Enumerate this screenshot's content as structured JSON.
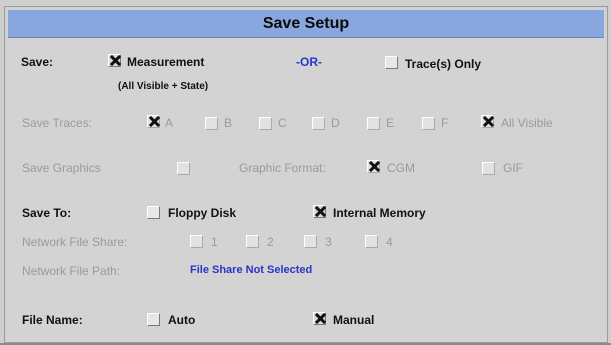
{
  "title": "Save Setup",
  "save": {
    "label": "Save:",
    "measurement": {
      "label": "Measurement",
      "checked": true
    },
    "measurement_note": "(All Visible + State)",
    "or": "-OR-",
    "traces_only": {
      "label": "Trace(s) Only",
      "checked": false
    }
  },
  "save_traces": {
    "label": "Save Traces:",
    "items": [
      {
        "label": "A",
        "checked": true
      },
      {
        "label": "B",
        "checked": false
      },
      {
        "label": "C",
        "checked": false
      },
      {
        "label": "D",
        "checked": false
      },
      {
        "label": "E",
        "checked": false
      },
      {
        "label": "F",
        "checked": false
      },
      {
        "label": "All Visible",
        "checked": true
      }
    ]
  },
  "save_graphics": {
    "label": "Save Graphics",
    "checked": false,
    "format_label": "Graphic Format:",
    "cgm": {
      "label": "CGM",
      "checked": true
    },
    "gif": {
      "label": "GIF",
      "checked": false
    }
  },
  "save_to": {
    "label": "Save To:",
    "floppy": {
      "label": "Floppy Disk",
      "checked": false
    },
    "internal": {
      "label": "Internal Memory",
      "checked": true
    }
  },
  "network_share": {
    "label": "Network File Share:",
    "items": [
      "1",
      "2",
      "3",
      "4"
    ]
  },
  "network_path": {
    "label": "Network File Path:",
    "value": "File Share Not Selected"
  },
  "file_name": {
    "label": "File Name:",
    "auto": {
      "label": "Auto",
      "checked": false
    },
    "manual": {
      "label": "Manual",
      "checked": true
    }
  },
  "colors": {
    "title_bg": "#8aa6df",
    "panel_bg": "#d3d3d3",
    "link_blue": "#2a34c8"
  }
}
